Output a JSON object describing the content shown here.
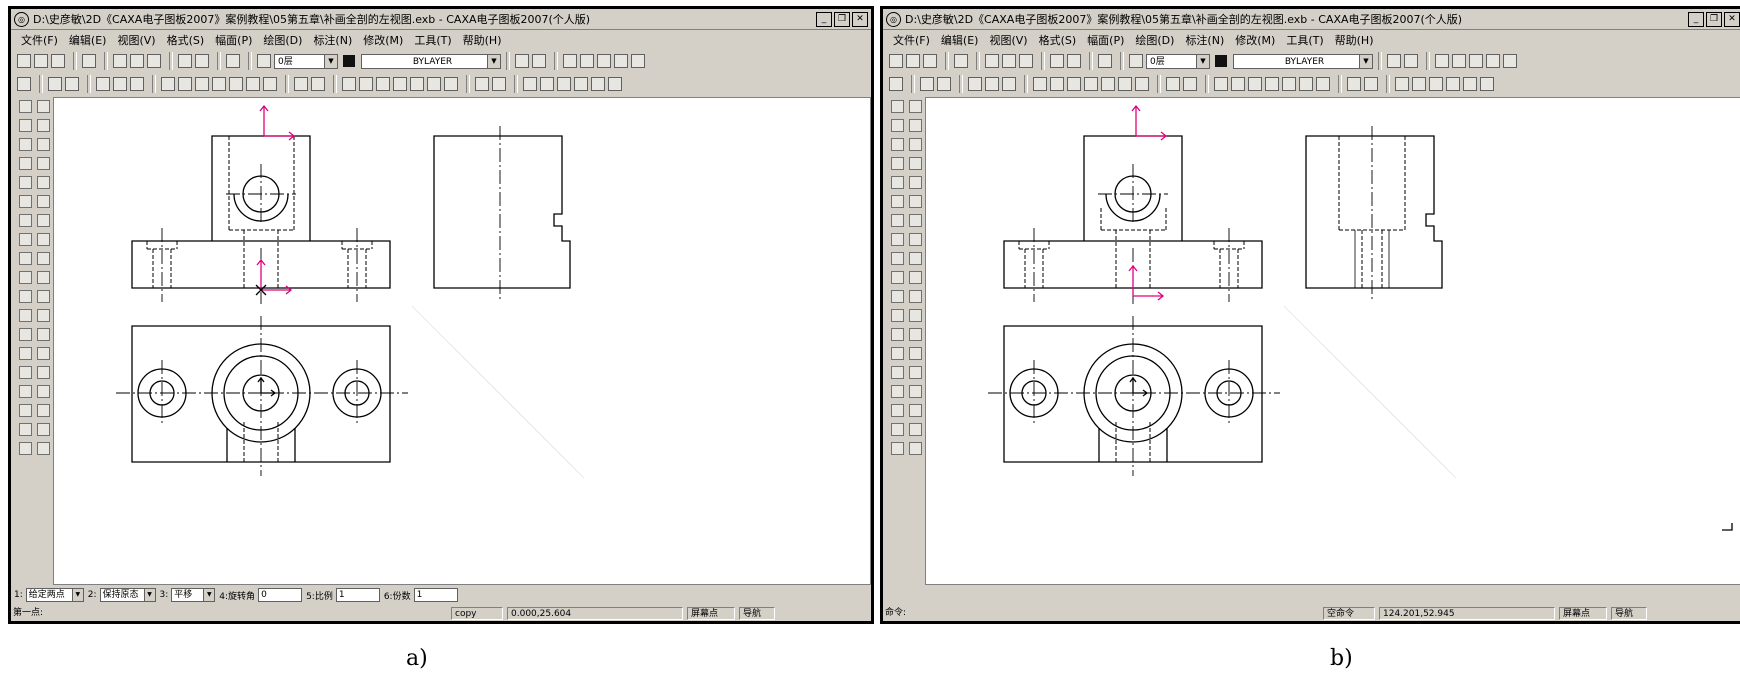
{
  "window_a": {
    "title": "D:\\史彦敏\\2D《CAXA电子图板2007》案例教程\\05第五章\\补画全剖的左视图.exb - CAXA电子图板2007(个人版)",
    "menu": [
      "文件(F)",
      "编辑(E)",
      "视图(V)",
      "格式(S)",
      "幅面(P)",
      "绘图(D)",
      "标注(N)",
      "修改(M)",
      "工具(T)",
      "帮助(H)"
    ],
    "layer_combo": "0层",
    "linetype_combo": "BYLAYER",
    "prop_bar": {
      "f1_label": "1:",
      "f1_value": "给定两点",
      "f2_label": "2:",
      "f2_value": "保持原态",
      "f3_label": "3:",
      "f3_value": "平移",
      "f4_label": "4:旋转角",
      "f4_value": "0",
      "f5_label": "5:比例",
      "f5_value": "1",
      "f6_label": "6:份数",
      "f6_value": "1"
    },
    "status": {
      "prompt": "第一点:",
      "command": "copy",
      "coords": "0.000,25.604",
      "snap": "屏幕点",
      "nav": "导航"
    },
    "caption": "a)"
  },
  "window_b": {
    "title": "D:\\史彦敏\\2D《CAXA电子图板2007》案例教程\\05第五章\\补画全剖的左视图.exb - CAXA电子图板2007(个人版)",
    "menu": [
      "文件(F)",
      "编辑(E)",
      "视图(V)",
      "格式(S)",
      "幅面(P)",
      "绘图(D)",
      "标注(N)",
      "修改(M)",
      "工具(T)",
      "帮助(H)"
    ],
    "layer_combo": "0层",
    "linetype_combo": "BYLAYER",
    "status": {
      "prompt": "命令:",
      "command": "空命令",
      "coords": "124.201,52.945",
      "snap": "屏幕点",
      "nav": "导航"
    },
    "caption": "b)"
  },
  "icons": [
    "app-logo-icon",
    "minimize-icon",
    "restore-icon",
    "close-icon",
    "new-file-icon",
    "open-file-icon",
    "save-icon",
    "print-icon",
    "cut-icon",
    "copy-icon",
    "paste-icon",
    "undo-icon",
    "redo-icon",
    "help-icon",
    "layer-icon",
    "color-icon",
    "line-icon",
    "circle-icon",
    "arc-icon",
    "text-icon",
    "move-icon",
    "mirror-icon",
    "zoom-icon",
    "pan-icon",
    "ucs-icon"
  ]
}
